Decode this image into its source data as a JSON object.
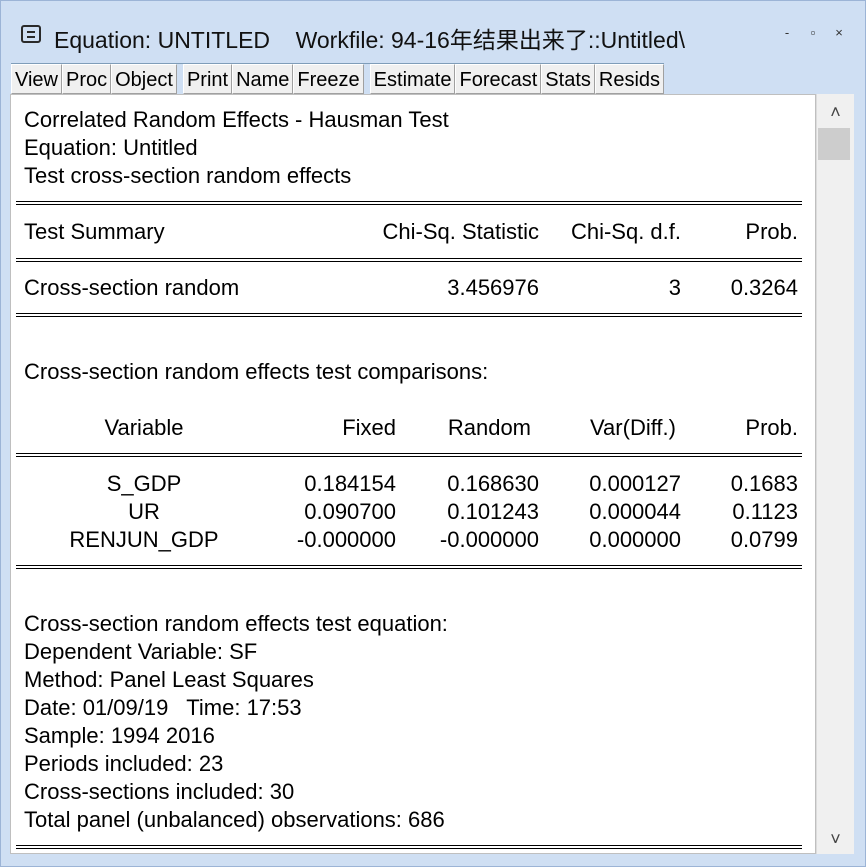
{
  "window": {
    "title": "Equation: UNTITLED    Workfile: 94-16年结果出来了::Untitled\\",
    "controls": [
      "-",
      "▫",
      "×"
    ]
  },
  "toolbar": {
    "group1": [
      "View",
      "Proc",
      "Object"
    ],
    "group2": [
      "Print",
      "Name",
      "Freeze"
    ],
    "group3": [
      "Estimate",
      "Forecast",
      "Stats",
      "Resids"
    ]
  },
  "output": {
    "header": [
      "Correlated Random Effects - Hausman Test",
      "Equation: Untitled",
      "Test cross-section random effects"
    ],
    "summary": {
      "headers": [
        "Test Summary",
        "Chi-Sq. Statistic",
        "Chi-Sq. d.f.",
        "Prob."
      ],
      "row": [
        "Cross-section random",
        "3.456976",
        "3",
        "0.3264"
      ]
    },
    "comparisons_title": "Cross-section random effects test comparisons:",
    "comparisons": {
      "headers": [
        "Variable",
        "Fixed",
        "Random",
        "Var(Diff.)",
        "Prob."
      ],
      "rows": [
        [
          "S_GDP",
          "0.184154",
          "0.168630",
          "0.000127",
          "0.1683"
        ],
        [
          "UR",
          "0.090700",
          "0.101243",
          "0.000044",
          "0.1123"
        ],
        [
          "RENJUN_GDP",
          "-0.000000",
          "-0.000000",
          "0.000000",
          "0.0799"
        ]
      ]
    },
    "equation_info": [
      "Cross-section random effects test equation:",
      "Dependent Variable: SF",
      "Method: Panel Least Squares",
      "Date: 01/09/19   Time: 17:53",
      "Sample: 1994 2016",
      "Periods included: 23",
      "Cross-sections included: 30",
      "Total panel (unbalanced) observations: 686"
    ]
  },
  "scrollbar": {
    "up": "˄",
    "down": "˅"
  }
}
